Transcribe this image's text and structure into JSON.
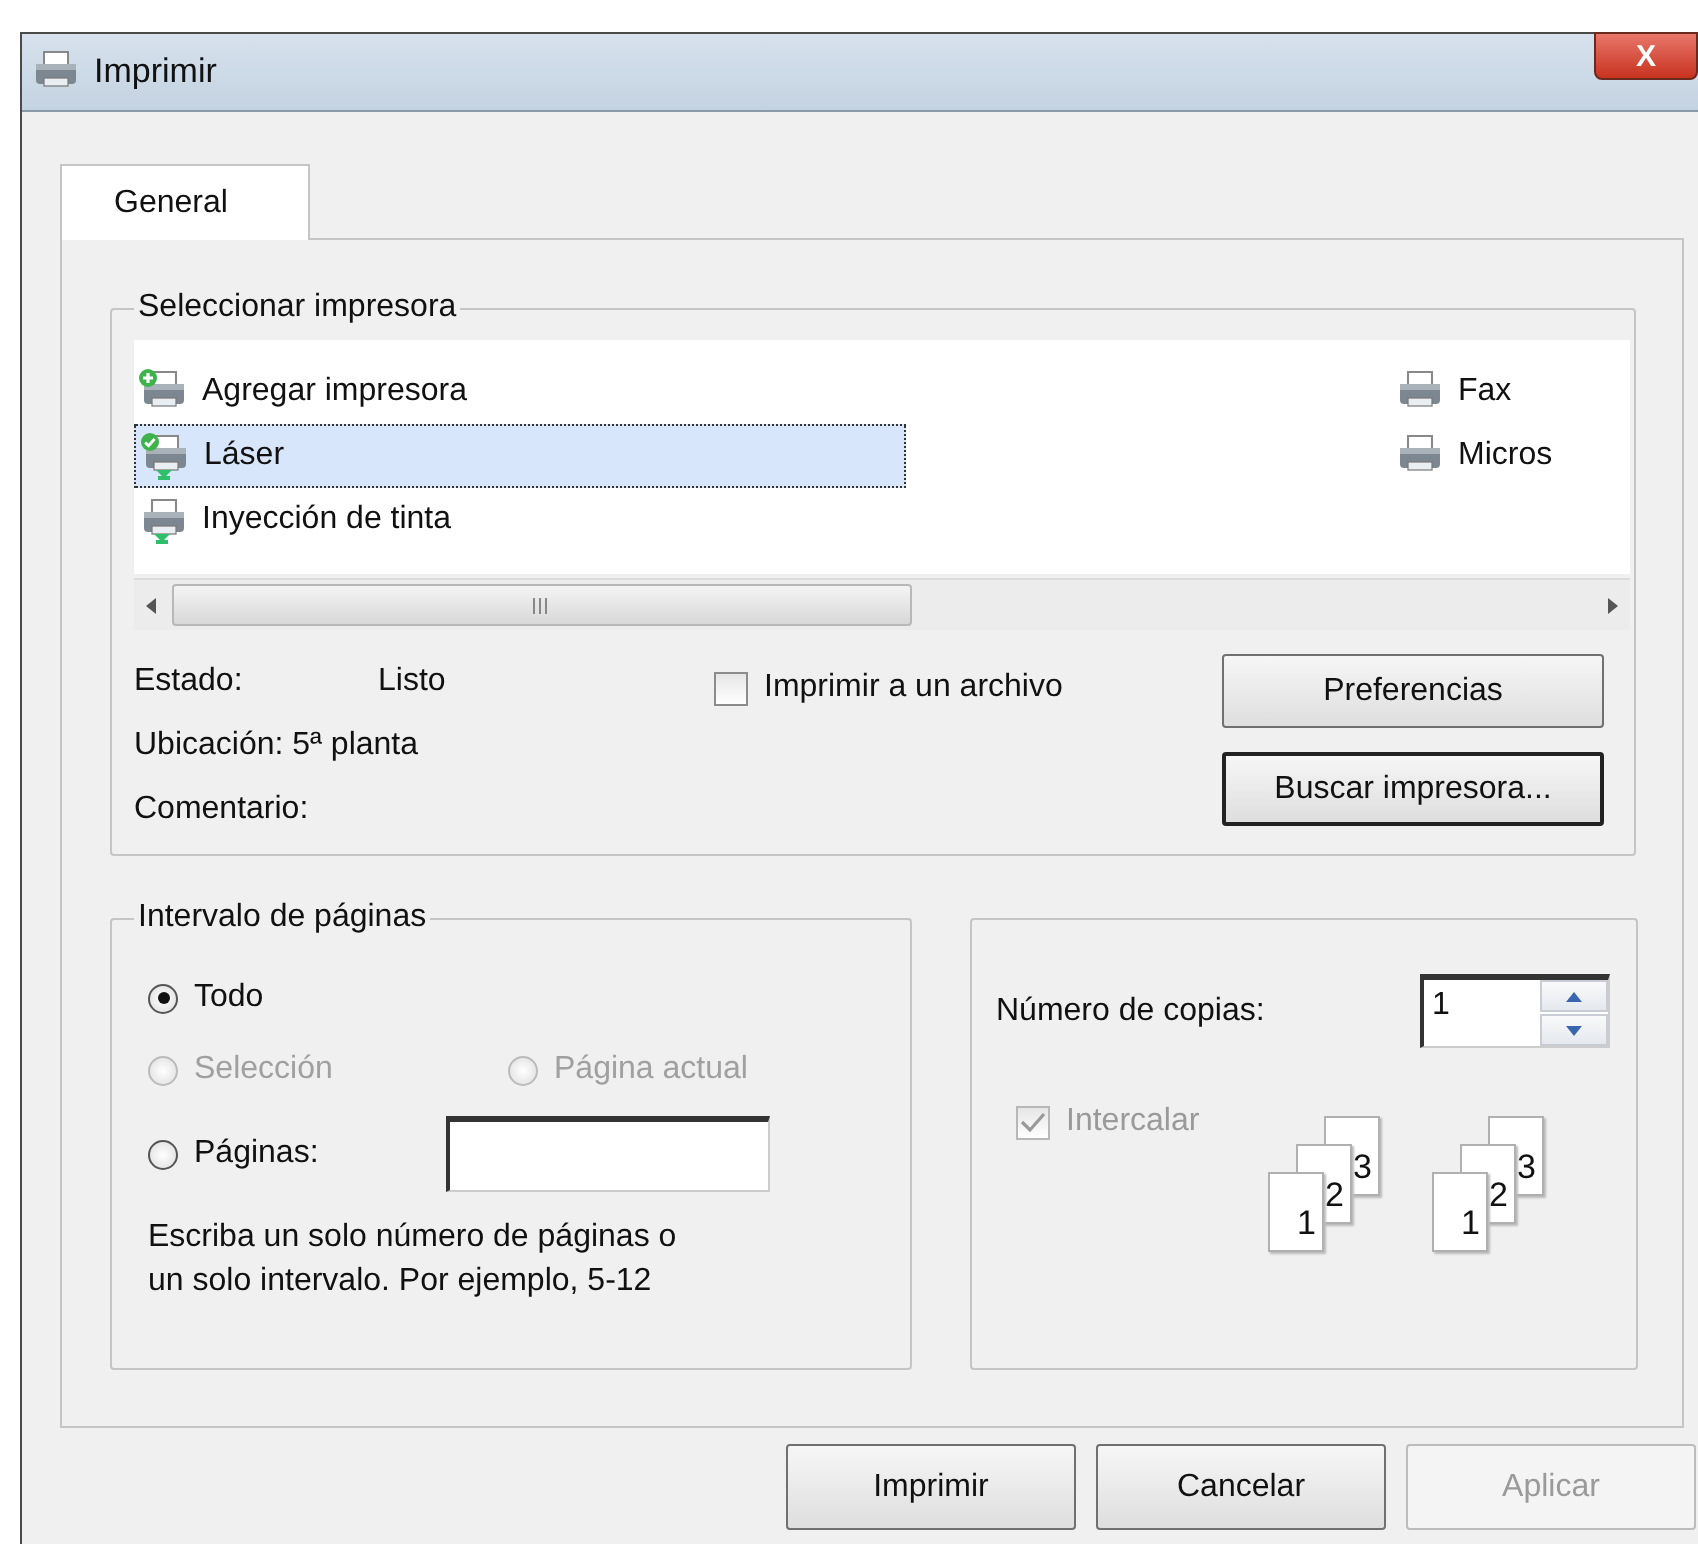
{
  "window": {
    "title": "Imprimir",
    "close_label": "X"
  },
  "tabs": [
    {
      "label": "General",
      "selected": true
    }
  ],
  "printer_group": {
    "legend": "Seleccionar impresora",
    "printers": [
      {
        "name": "Agregar impresora",
        "add": true,
        "selected": false,
        "default": false,
        "shared": false
      },
      {
        "name": "Láser",
        "add": false,
        "selected": true,
        "default": true,
        "shared": true
      },
      {
        "name": "Inyección de tinta",
        "add": false,
        "selected": false,
        "default": false,
        "shared": true
      },
      {
        "name": "Fax",
        "add": false,
        "selected": false,
        "default": false,
        "shared": false
      },
      {
        "name": "Micros",
        "add": false,
        "selected": false,
        "default": false,
        "shared": false
      }
    ],
    "details": [
      {
        "label": "Estado:",
        "value": "Listo"
      },
      {
        "label": "Ubicación: 5ª planta"
      },
      {
        "label": "Comentario:"
      }
    ],
    "print_to_file": {
      "label": "Imprimir a un archivo",
      "checked": false
    },
    "buttons": [
      {
        "label": "Preferencias",
        "default": false
      },
      {
        "label": "Buscar impresora...",
        "default": true
      }
    ]
  },
  "page_range": {
    "legend": "Intervalo de páginas",
    "options": [
      {
        "label": "Todo",
        "selected": true,
        "disabled": false
      },
      {
        "label": "Selección",
        "selected": false,
        "disabled": true
      },
      {
        "label": "Página actual",
        "selected": false,
        "disabled": true
      },
      {
        "label": "Páginas:",
        "selected": false,
        "disabled": false
      }
    ],
    "hint": "Escriba un solo número de páginas o un solo intervalo. Por ejemplo, 5-12"
  },
  "copies": {
    "label": "Número de copias:",
    "value": "1",
    "collate": {
      "label": "Intercalar",
      "checked": true,
      "disabled": true
    },
    "stacks": [
      [
        "1",
        "2",
        "3"
      ],
      [
        "1",
        "2",
        "3"
      ]
    ]
  },
  "footer_buttons": [
    {
      "label": "Imprimir",
      "disabled": false
    },
    {
      "label": "Cancelar",
      "disabled": false
    },
    {
      "label": "Aplicar",
      "disabled": true
    }
  ]
}
